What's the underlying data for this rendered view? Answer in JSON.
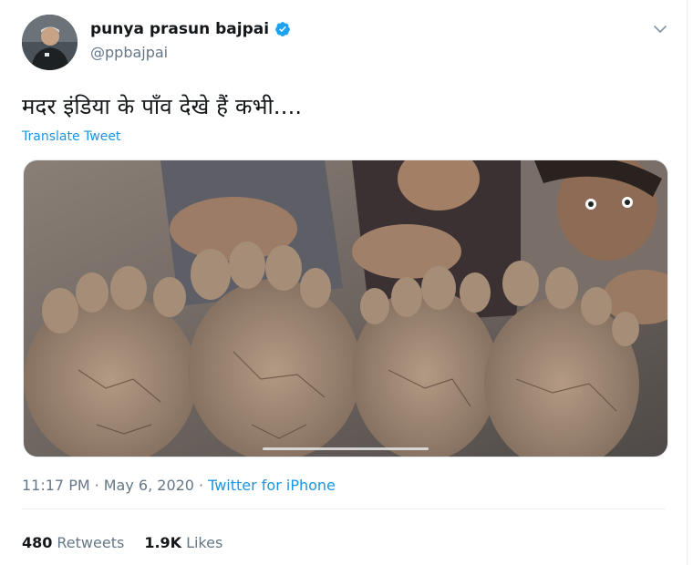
{
  "author": {
    "display_name": "punya prasun bajpai",
    "handle": "@ppbajpai",
    "verified": true
  },
  "tweet": {
    "text": "मदर इंडिया के पाँव देखे हैं कभी....",
    "translate_label": "Translate Tweet"
  },
  "media": {
    "description_icon": "photo"
  },
  "meta": {
    "time": "11:17 PM",
    "separator": "·",
    "date": "May 6, 2020",
    "source": "Twitter for iPhone"
  },
  "stats": {
    "retweets_count": "480",
    "retweets_label": "Retweets",
    "likes_count": "1.9K",
    "likes_label": "Likes"
  },
  "colors": {
    "link": "#1b95e0",
    "secondary_text": "#657786",
    "primary_text": "#14171a",
    "verified_badge": "#1da1f2"
  }
}
